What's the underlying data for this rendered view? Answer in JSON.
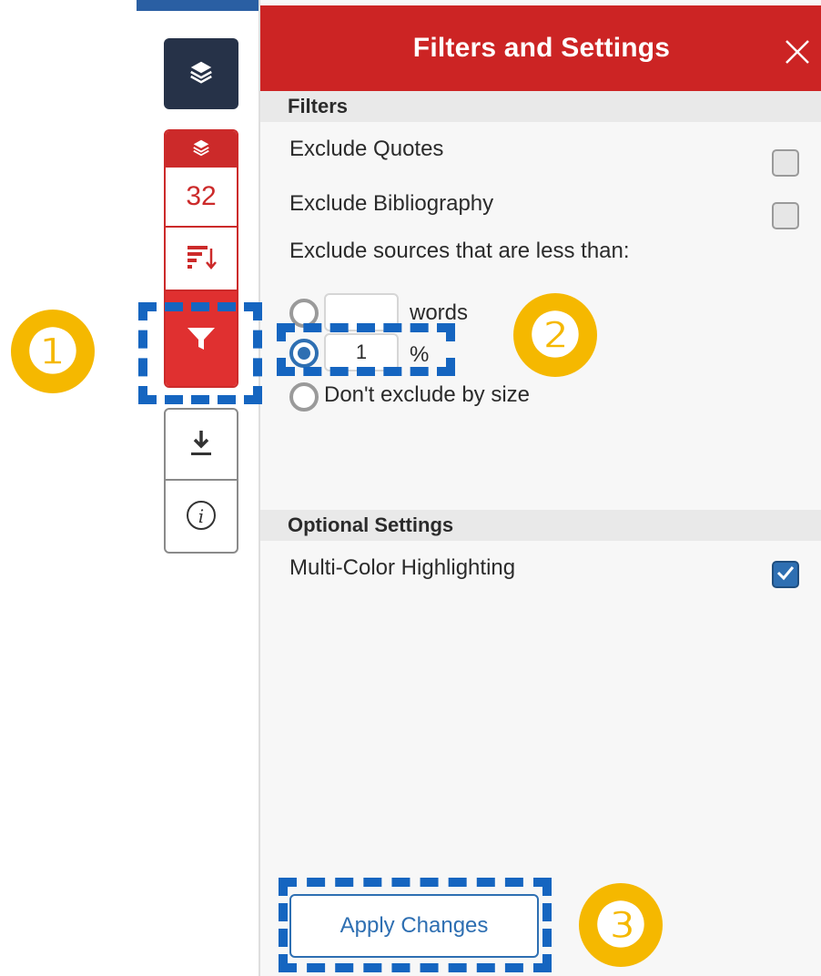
{
  "sidebar": {
    "layers_icon": "layers-icon",
    "score": "32",
    "sort_icon": "sort-icon",
    "filter_icon": "filter-icon",
    "download_icon": "download-icon",
    "info_icon": "info-icon"
  },
  "panel": {
    "title": "Filters and Settings",
    "close_icon": "close-icon",
    "filters_heading": "Filters",
    "exclude_quotes_label": "Exclude Quotes",
    "exclude_quotes_checked": false,
    "exclude_bibliography_label": "Exclude Bibliography",
    "exclude_bibliography_checked": false,
    "exclude_size_label": "Exclude sources that are less than:",
    "size_options": [
      {
        "value": "",
        "unit": "words",
        "selected": false
      },
      {
        "value": "1",
        "unit": "%",
        "selected": true
      },
      {
        "unit": "Don't exclude by size",
        "selected": false
      }
    ],
    "optional_heading": "Optional Settings",
    "multicolor_label": "Multi-Color Highlighting",
    "multicolor_checked": true,
    "apply_label": "Apply Changes"
  },
  "annotations": {
    "step1": "❶",
    "step2": "❷",
    "step3": "❸"
  },
  "colors": {
    "accent_red": "#cc2424",
    "accent_blue": "#2e6fb2",
    "highlight_blue": "#1565c0",
    "badge_gold": "#f5b800",
    "dark_navy": "#263248"
  }
}
